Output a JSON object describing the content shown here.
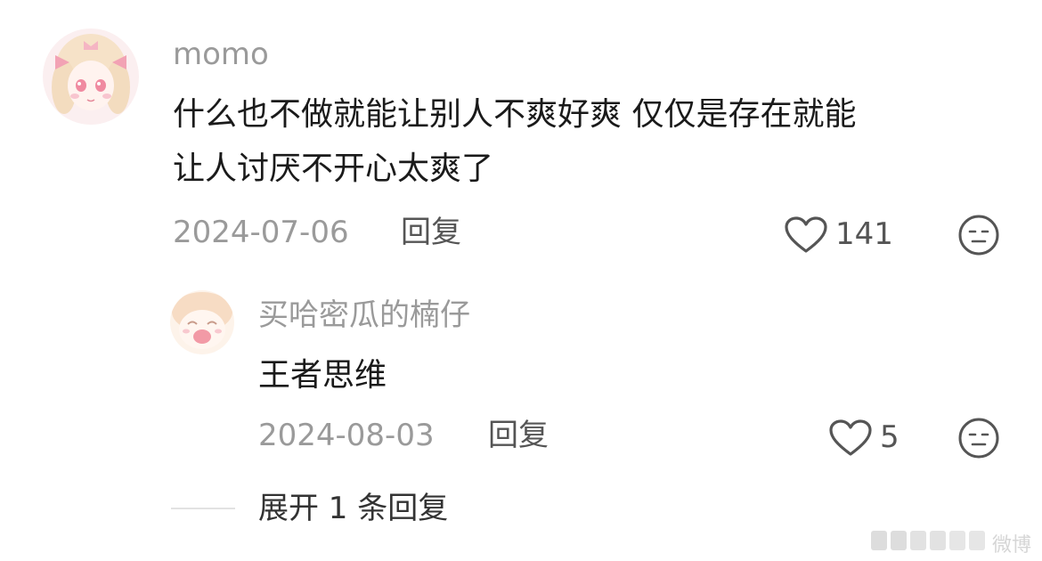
{
  "comment": {
    "username": "momo",
    "content_line1": "什么也不做就能让别人不爽好爽 仅仅是存在就能",
    "content_line2": "让人讨厌不开心太爽了",
    "date": "2024-07-06",
    "reply_label": "回复",
    "likes": "141"
  },
  "reply": {
    "username": "买哈密瓜的楠仔",
    "content": "王者思维",
    "date": "2024-08-03",
    "reply_label": "回复",
    "likes": "5"
  },
  "expand_label": "展开 1 条回复",
  "watermark_label": "微博",
  "icons": {
    "like": "heart-outline-icon",
    "dislike": "neutral-face-icon"
  },
  "colors": {
    "text_primary": "#1a1a1a",
    "text_secondary": "#9a9a9a",
    "icon": "#555555"
  }
}
